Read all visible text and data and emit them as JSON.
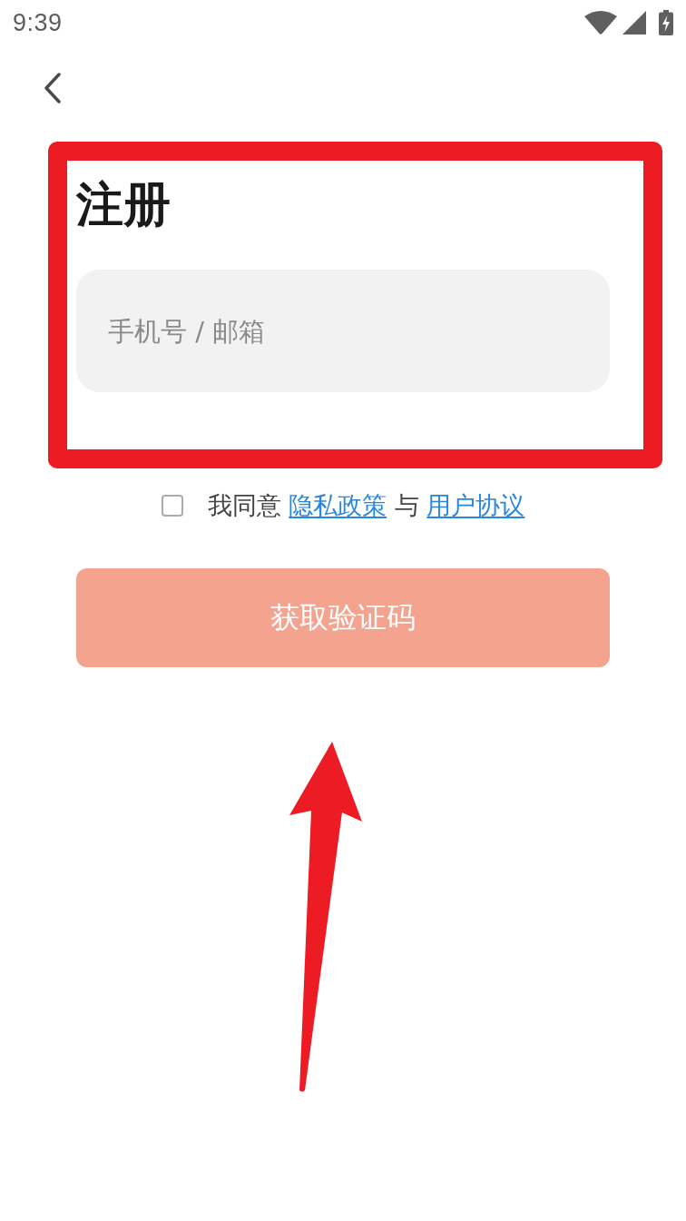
{
  "status_bar": {
    "time": "9:39"
  },
  "title": "注册",
  "account_field": {
    "placeholder": "手机号 / 邮箱"
  },
  "agreement": {
    "checked": false,
    "parts": [
      {
        "kind": "text",
        "text": "我同意"
      },
      {
        "kind": "link",
        "text": "隐私政策"
      },
      {
        "kind": "text",
        "text": "与"
      },
      {
        "kind": "link",
        "text": "用户协议"
      }
    ]
  },
  "submit_button": {
    "label": "获取验证码",
    "disabled": true
  },
  "annotations": {
    "highlight_frame": true,
    "pointer_arrow": true
  }
}
